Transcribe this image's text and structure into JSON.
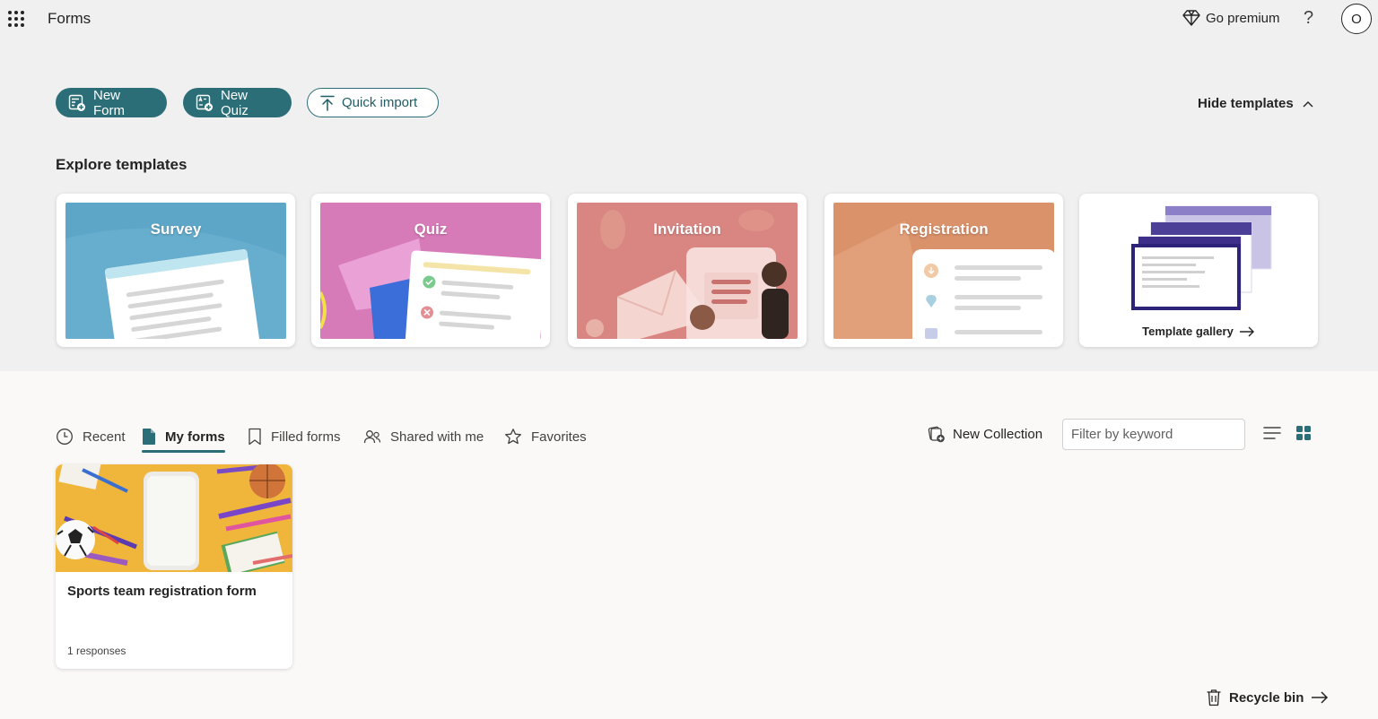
{
  "header": {
    "app_title": "Forms",
    "premium_label": "Go premium",
    "help_label": "?",
    "avatar_initial": "O"
  },
  "actions": {
    "new_form": "New Form",
    "new_quiz": "New Quiz",
    "quick_import": "Quick import",
    "hide_templates": "Hide templates"
  },
  "templates": {
    "heading": "Explore templates",
    "items": [
      {
        "title": "Survey"
      },
      {
        "title": "Quiz"
      },
      {
        "title": "Invitation"
      },
      {
        "title": "Registration"
      }
    ],
    "gallery_label": "Template gallery"
  },
  "tabs": [
    {
      "label": "Recent",
      "icon": "clock-icon"
    },
    {
      "label": "My forms",
      "icon": "document-icon",
      "active": true
    },
    {
      "label": "Filled forms",
      "icon": "bookmark-icon"
    },
    {
      "label": "Shared with me",
      "icon": "people-icon"
    },
    {
      "label": "Favorites",
      "icon": "star-icon"
    }
  ],
  "toolbar": {
    "new_collection": "New Collection",
    "filter_placeholder": "Filter by keyword"
  },
  "forms": [
    {
      "name": "Sports team registration form",
      "responses": "1 responses"
    }
  ],
  "footer": {
    "recycle_bin": "Recycle bin"
  },
  "colors": {
    "accent": "#2c6e78",
    "top_band": "#f0f0f0",
    "page_bg": "#faf9f8"
  }
}
